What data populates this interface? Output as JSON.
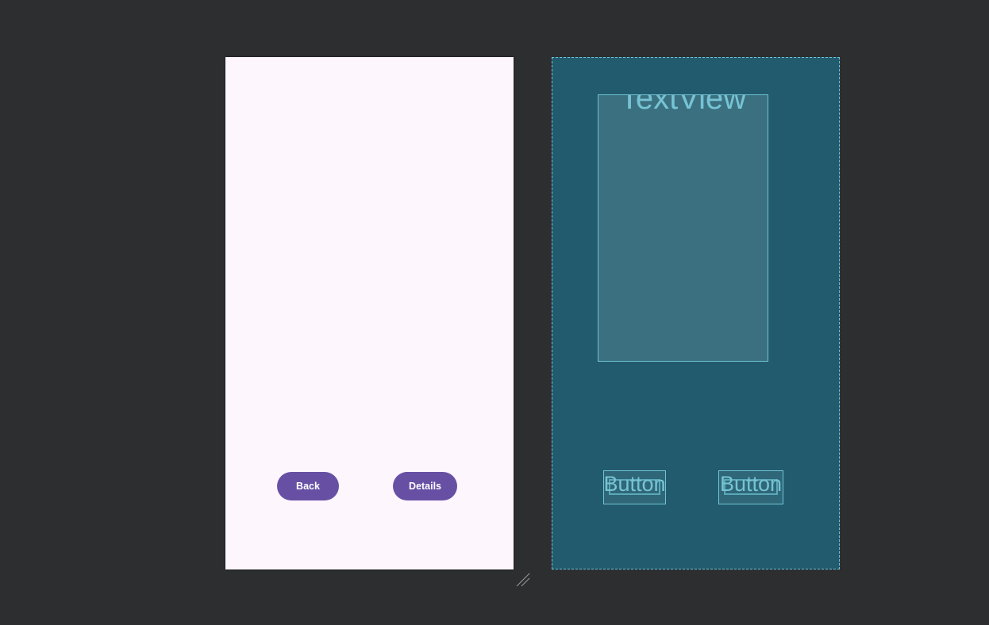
{
  "colors": {
    "workspace_bg": "#2d2e30",
    "design_bg": "#fdf6fd",
    "button_primary": "#6750a4",
    "blueprint_bg": "#235b6e",
    "blueprint_stroke": "#6fc3d6",
    "blueprint_text": "#76c3d4"
  },
  "design": {
    "buttons": [
      {
        "label": "Back"
      },
      {
        "label": "Details"
      }
    ]
  },
  "blueprint": {
    "textview_label": "TextView",
    "buttons": [
      {
        "label": "Button"
      },
      {
        "label": "Button"
      }
    ]
  },
  "icons": {
    "resize_handle": "resize-handle-icon"
  }
}
